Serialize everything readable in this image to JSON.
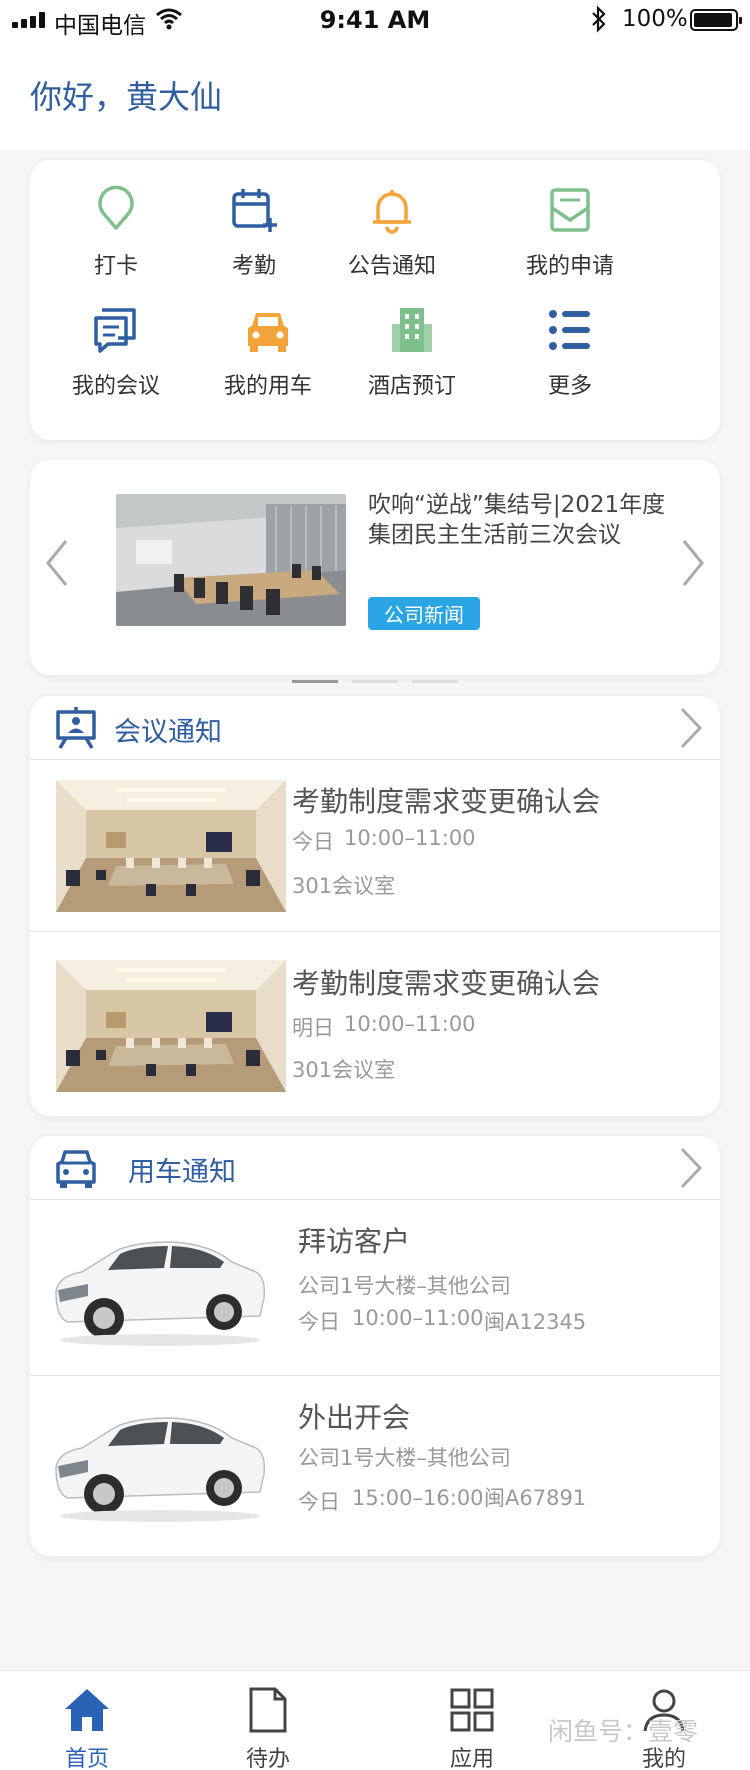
{
  "status_bar": {
    "carrier": "中国电信",
    "time": "9:41 AM",
    "battery": "100%"
  },
  "greeting": "你好，黄大仙",
  "quick_actions": [
    {
      "label": "打卡",
      "icon": "location-pin-icon",
      "color": "#7fbf8c"
    },
    {
      "label": "考勤",
      "icon": "calendar-add-icon",
      "color": "#2f5fa0"
    },
    {
      "label": "公告通知",
      "icon": "bell-icon",
      "color": "#f2a33a"
    },
    {
      "label": "我的申请",
      "icon": "mail-icon",
      "color": "#7fbf8c"
    },
    {
      "label": "我的会议",
      "icon": "chat-icon",
      "color": "#2f5fa0"
    },
    {
      "label": "我的用车",
      "icon": "car-icon",
      "color": "#f2a33a"
    },
    {
      "label": "酒店预订",
      "icon": "building-icon",
      "color": "#7fbf8c"
    },
    {
      "label": "更多",
      "icon": "list-icon",
      "color": "#2f5fa0"
    }
  ],
  "news": {
    "title": "吹响“逆战”集结号|2021年度集团民主生活前三次会议",
    "tag": "公司新闻"
  },
  "meeting": {
    "title": "会议通知",
    "items": [
      {
        "name": "考勤制度需求变更确认会",
        "day": "今日",
        "time": "10:00–11:00",
        "room": "301会议室"
      },
      {
        "name": "考勤制度需求变更确认会",
        "day": "明日",
        "time": "10:00–11:00",
        "room": "301会议室"
      }
    ]
  },
  "car": {
    "title": "用车通知",
    "items": [
      {
        "name": "拜访客户",
        "route": "公司1号大楼–其他公司",
        "day": "今日",
        "time": "10:00–11:00",
        "plate": "闽A12345"
      },
      {
        "name": "外出开会",
        "route": "公司1号大楼–其他公司",
        "day": "今日",
        "time": "15:00–16:00",
        "plate": "闽A67891"
      }
    ]
  },
  "tabbar": [
    {
      "label": "首页",
      "icon": "home-icon",
      "active": true
    },
    {
      "label": "待办",
      "icon": "document-icon",
      "active": false
    },
    {
      "label": "应用",
      "icon": "grid-icon",
      "active": false
    },
    {
      "label": "我的",
      "icon": "user-icon",
      "active": false
    }
  ],
  "watermark": "闲鱼号：壹零",
  "colors": {
    "primary": "#2f5fa0",
    "tag": "#2aa5e3",
    "green": "#7fbf8c",
    "orange": "#f2a33a"
  }
}
